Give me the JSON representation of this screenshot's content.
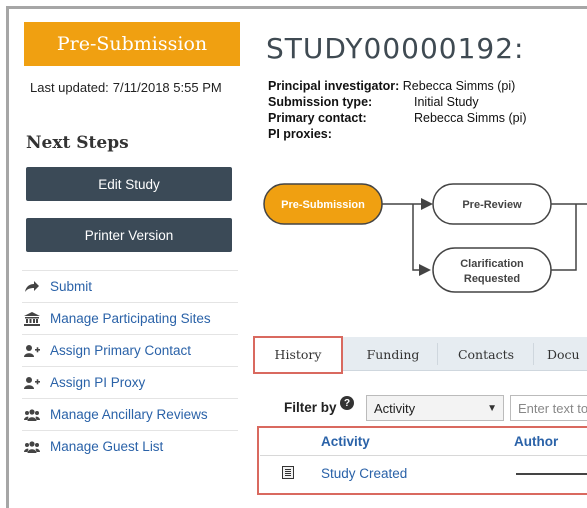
{
  "sidebar": {
    "status": "Pre-Submission",
    "last_updated_label": "Last updated:",
    "last_updated_value": "7/11/2018 5:55 PM",
    "next_steps_heading": "Next Steps",
    "buttons": {
      "edit": "Edit Study",
      "print": "Printer Version"
    },
    "actions": [
      {
        "label": "Submit",
        "icon": "arrow-right-icon"
      },
      {
        "label": "Manage Participating Sites",
        "icon": "institution-icon"
      },
      {
        "label": "Assign Primary Contact",
        "icon": "add-user-icon"
      },
      {
        "label": "Assign PI Proxy",
        "icon": "add-user-icon"
      },
      {
        "label": "Manage Ancillary Reviews",
        "icon": "group-icon"
      },
      {
        "label": "Manage Guest List",
        "icon": "group-icon"
      }
    ]
  },
  "study": {
    "title": "STUDY00000192:",
    "fields": {
      "pi_label": "Principal investigator:",
      "pi_value": "Rebecca Simms (pi)",
      "type_label": "Submission type:",
      "type_value": "Initial Study",
      "contact_label": "Primary contact:",
      "contact_value": "Rebecca Simms (pi)",
      "proxies_label": "PI proxies:"
    }
  },
  "workflow": {
    "states": [
      {
        "label": "Pre-Submission",
        "current": true
      },
      {
        "label": "Pre-Review",
        "current": false
      },
      {
        "label": "Clarification",
        "label2": "Requested",
        "current": false
      }
    ],
    "colors": {
      "current": "#f0a011",
      "node_fill": "#ffffff",
      "stroke": "#444444"
    }
  },
  "tabs": [
    {
      "label": "History",
      "active": true
    },
    {
      "label": "Funding",
      "active": false
    },
    {
      "label": "Contacts",
      "active": false
    },
    {
      "label": "Docu",
      "active": false
    }
  ],
  "filter": {
    "label": "Filter by",
    "help_icon": "?",
    "selected": "Activity",
    "placeholder": "Enter text to"
  },
  "history_table": {
    "columns": [
      "Activity",
      "Author"
    ],
    "rows": [
      {
        "activity": "Study Created",
        "author": ""
      }
    ]
  },
  "colors": {
    "accent": "#f0a011",
    "button": "#3b4a57",
    "link": "#2a62a8",
    "highlight": "#d9695f",
    "tabbar": "#e6ecf1"
  }
}
